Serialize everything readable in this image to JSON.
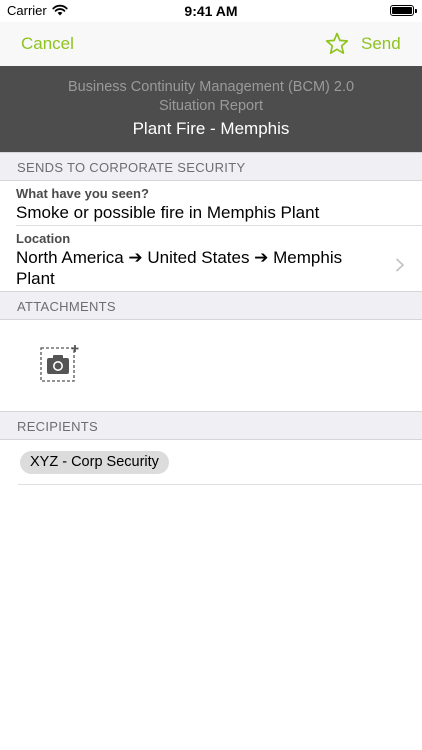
{
  "status_bar": {
    "carrier": "Carrier",
    "time": "9:41 AM"
  },
  "nav": {
    "cancel_label": "Cancel",
    "send_label": "Send",
    "accent_color": "#8fc31f"
  },
  "banner": {
    "line1": "Business Continuity Management (BCM) 2.0",
    "line2": "Situation Report",
    "title": "Plant Fire - Memphis"
  },
  "sections": {
    "sends_to": "SENDS TO CORPORATE SECURITY",
    "attachments": "ATTACHMENTS",
    "recipients": "RECIPIENTS"
  },
  "fields": {
    "seen_label": "What have you seen?",
    "seen_value": "Smoke or possible fire in Memphis Plant",
    "location_label": "Location",
    "location_line1": "North America ➔ United States ➔ Memphis",
    "location_line2": "Plant"
  },
  "recipients": [
    "XYZ - Corp Security"
  ],
  "icons": {
    "wifi": "wifi-icon",
    "battery": "battery-icon",
    "star": "star-icon",
    "chevron": "chevron-right-icon",
    "camera": "camera-add-icon"
  }
}
